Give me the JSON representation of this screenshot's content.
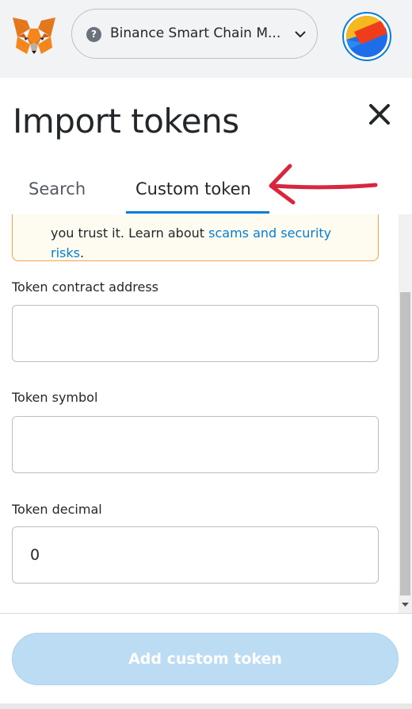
{
  "header": {
    "network": {
      "label": "Binance Smart Chain M...",
      "help_glyph": "?",
      "chevron_icon": "chevron-down-icon"
    },
    "logo_icon": "metamask-fox-icon",
    "avatar_icon": "account-avatar-icon"
  },
  "modal": {
    "title": "Import tokens",
    "close_icon": "close-icon",
    "tabs": [
      {
        "label": "Search",
        "active": false
      },
      {
        "label": "Custom token",
        "active": true
      }
    ],
    "notice": {
      "text_prefix": "you trust it. Learn about ",
      "link_text": "scams and security risks",
      "text_suffix": "."
    },
    "fields": [
      {
        "label": "Token contract address",
        "value": "",
        "placeholder": ""
      },
      {
        "label": "Token symbol",
        "value": "",
        "placeholder": ""
      },
      {
        "label": "Token decimal",
        "value": "0",
        "placeholder": ""
      }
    ],
    "submit_label": "Add custom token"
  },
  "colors": {
    "accent": "#037dd6",
    "annotation_arrow": "#d7263d",
    "notice_border": "#f8a24a",
    "disabled_button": "#bcdcf3"
  }
}
